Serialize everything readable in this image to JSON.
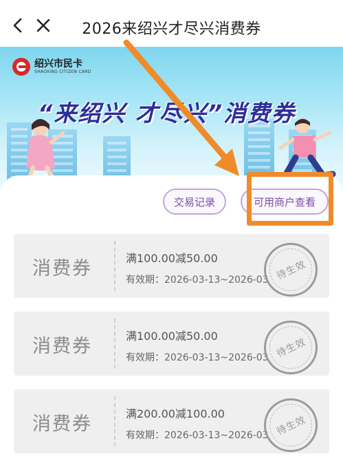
{
  "header": {
    "title": "2026来绍兴才尽兴消费券",
    "back_icon": "chevron-left-icon",
    "close_icon": "close-icon"
  },
  "banner": {
    "logo_cn": "绍兴市民卡",
    "logo_en": "SHAOXING CITIZEN CARD",
    "slogan": "“来绍兴 才尽兴”消费券"
  },
  "actions": {
    "records_label": "交易记录",
    "merchants_label": "可用商户查看"
  },
  "coupons": [
    {
      "name": "消费券",
      "amount": "满100.00减50.00",
      "validity": "有效期：2026-03-13~2026-03",
      "stamp": "待生效"
    },
    {
      "name": "消费券",
      "amount": "满100.00减50.00",
      "validity": "有效期：2026-03-13~2026-03",
      "stamp": "待生效"
    },
    {
      "name": "消费券",
      "amount": "满200.00减100.00",
      "validity": "有效期：2026-03-13~2026-03",
      "stamp": "待生效"
    }
  ],
  "colors": {
    "accent_orange": "#f08b2a",
    "pill_border": "#c1a4d9",
    "pill_text": "#7a4aa8",
    "coupon_bg": "#efefef"
  }
}
